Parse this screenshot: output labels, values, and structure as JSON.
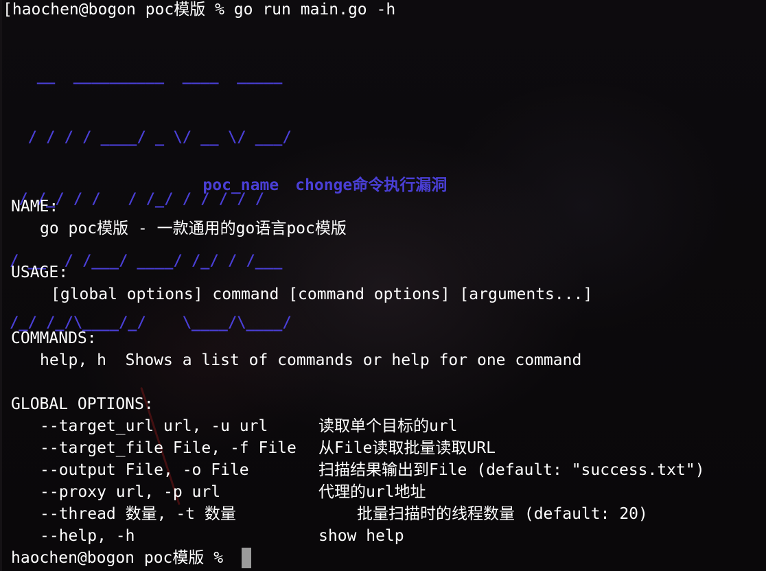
{
  "prompt_cmd": "[haochen@bogon poc模版 % go run main.go -h",
  "ascii_art": [
    "   __  __________  ____  _____",
    "  / / / / ____/ _ \\/ __ \\/ ___/",
    " / /_/ / /   / /_/ / / / / /",
    "/ __  / /___/ ____/ /_/ / /___",
    "/_/ /_/\\____/_/    \\____/\\____/"
  ],
  "poc": {
    "name_label": "poc_name",
    "desc": "chonge命令执行漏洞"
  },
  "name_section": {
    "header": "NAME:",
    "body": "go poc模版 - 一款通用的go语言poc模版"
  },
  "usage_section": {
    "header": "USAGE:",
    "body": "[global options] command [command options] [arguments...]"
  },
  "commands_section": {
    "header": "COMMANDS:",
    "body": "help, h  Shows a list of commands or help for one command"
  },
  "global_options": {
    "header": "GLOBAL OPTIONS:",
    "options": [
      {
        "flag": "--target_url url, -u url",
        "desc": "读取单个目标的url"
      },
      {
        "flag": "--target_file File, -f File",
        "desc": "从File读取批量读取URL"
      },
      {
        "flag": "--output File, -o File",
        "desc": "扫描结果输出到File (default: \"success.txt\")"
      },
      {
        "flag": "--proxy url, -p url",
        "desc": "代理的url地址"
      },
      {
        "flag": "--thread 数量, -t 数量",
        "desc": "批量扫描时的线程数量 (default: 20)"
      },
      {
        "flag": "--help, -h",
        "desc": "show help"
      }
    ]
  },
  "prompt_end": "haochen@bogon poc模版 %",
  "colors": {
    "ascii": "#4a3fd6",
    "text": "#ffffff",
    "background": "#0b090b",
    "cursor": "#9b9b9b"
  }
}
